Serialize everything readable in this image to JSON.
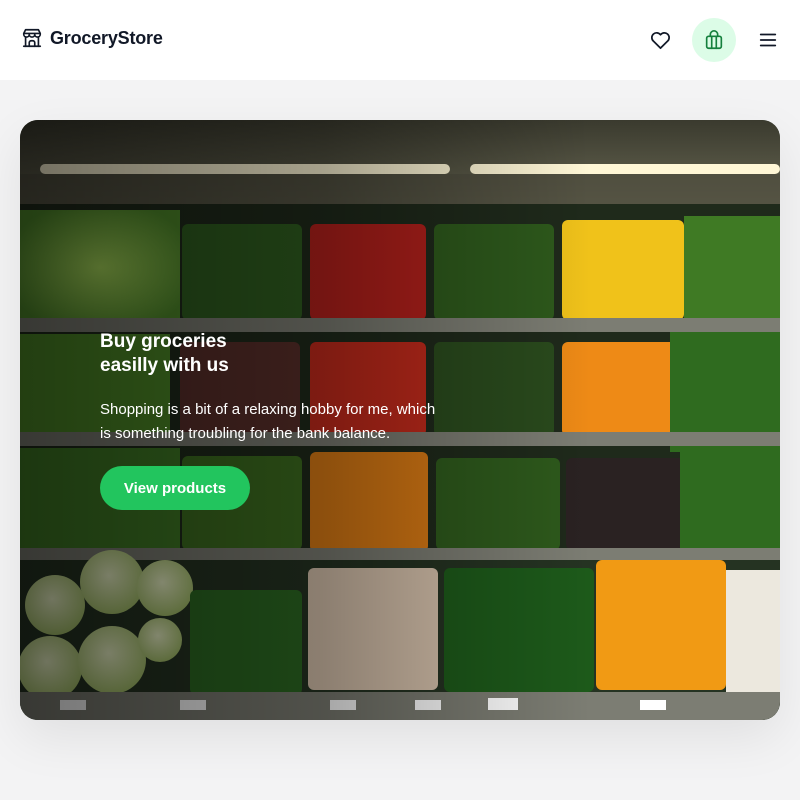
{
  "header": {
    "brand": "GroceryStore",
    "icons": {
      "logo": "store-icon",
      "favorites": "heart-icon",
      "cart": "shopping-bag-icon",
      "menu": "hamburger-menu-icon"
    }
  },
  "hero": {
    "title_line1": "Buy groceries",
    "title_line2": "easilly with us",
    "description_line1": "Shopping is a bit of a relaxing hobby for me, which",
    "description_line2": "is something troubling for the bank balance.",
    "cta_label": "View products",
    "image": "grocery-shelves-photo"
  },
  "colors": {
    "accent": "#22c55e",
    "accent_soft": "#dcfce7",
    "text": "#111827",
    "background": "#f3f3f4"
  }
}
